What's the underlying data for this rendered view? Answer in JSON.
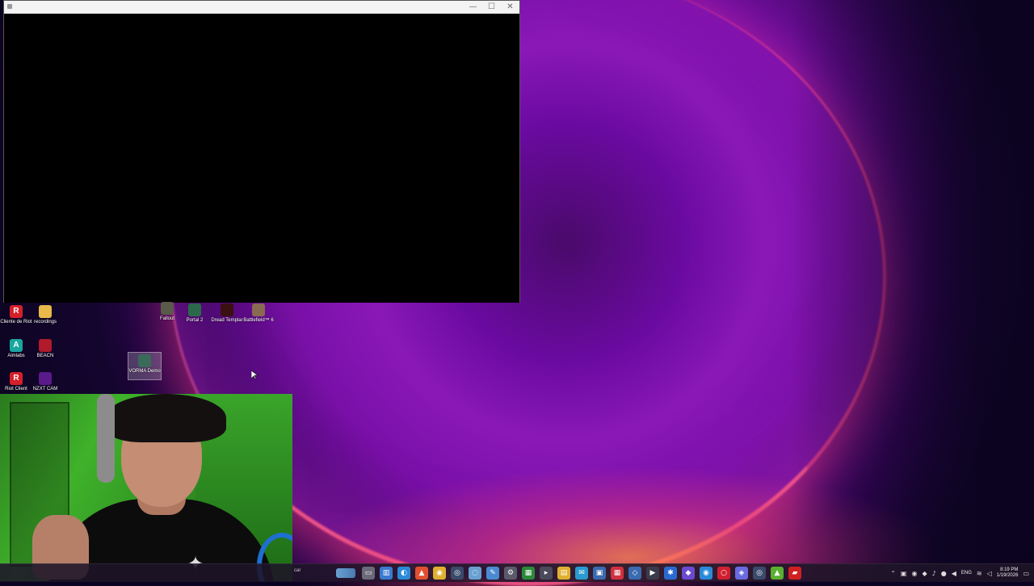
{
  "window": {
    "minimize_glyph": "—",
    "maximize_glyph": "☐",
    "close_glyph": "✕"
  },
  "desktop_icons": {
    "cliente_riot": "Cliente de Riot",
    "recordings": "recordings",
    "fallout": "Fallout",
    "portal2": "Portal 2",
    "dread_templar": "Dread Templar",
    "battlefield": "Battlefield™ 6",
    "aimlabs": "Aimlabs",
    "beacn": "BEACN",
    "vorma": "VORMA Demo",
    "riot_client": "Riot Client",
    "nzxt_cam": "NZXT CAM"
  },
  "taskbar": {
    "search_text": "car",
    "lang": "ENG",
    "time": "8:19 PM",
    "date": "1/19/2026",
    "icons": [
      "widgets-icon",
      "file-explorer-icon",
      "edge-icon",
      "brave-icon",
      "chrome-icon",
      "steam-icon",
      "capture-icon",
      "snipping-icon",
      "settings-icon",
      "xbox-icon",
      "terminal-icon",
      "explorer-icon",
      "notes-icon",
      "store-icon",
      "calendar-icon",
      "vscode-icon",
      "media-icon",
      "bluetooth-icon",
      "figma-icon",
      "chrome2-icon",
      "opera-icon",
      "discord-icon",
      "steam2-icon",
      "nvidia-icon",
      "acrobat-icon"
    ]
  },
  "colors": {
    "wallpaper_accent": "#c02fb8",
    "webcam_green": "#3fb22a",
    "taskbar_bg": "#1e1428"
  }
}
